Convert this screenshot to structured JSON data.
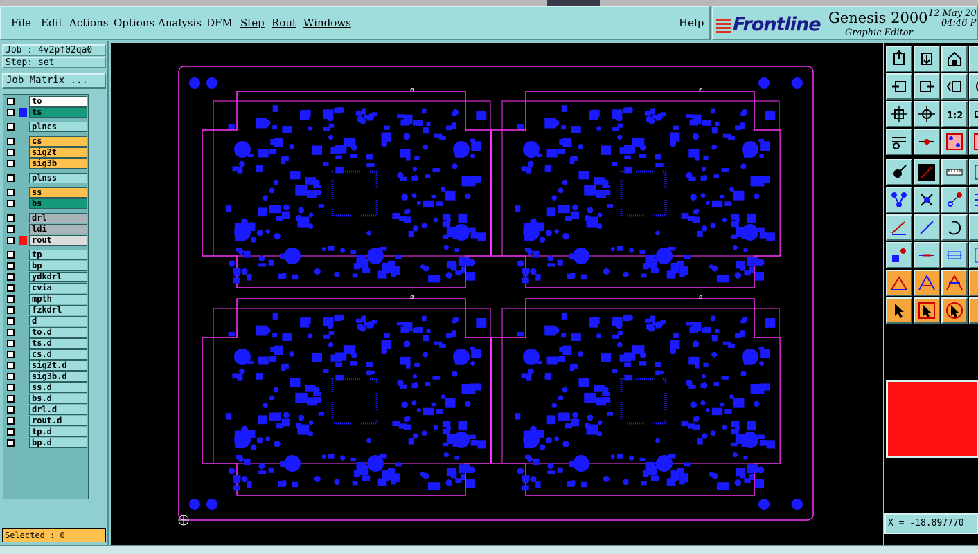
{
  "menubar": {
    "items": [
      {
        "label": "File"
      },
      {
        "label": "Edit"
      },
      {
        "label": "Actions"
      },
      {
        "label": "Options"
      },
      {
        "label": "Analysis"
      },
      {
        "label": "DFM"
      },
      {
        "label": "Step"
      },
      {
        "label": "Rout"
      },
      {
        "label": "Windows"
      }
    ],
    "help_label": "Help"
  },
  "brand": {
    "logo_text": "Frontline",
    "product": "Genesis 2000",
    "subtitle": "Graphic Editor",
    "date": "12 May 20",
    "time": "04:46 P"
  },
  "job": {
    "label": "Job : 4v2pf02qa0",
    "step": "Step: set",
    "matrix_button": "Job Matrix ..."
  },
  "layers": [
    {
      "name": "to",
      "bg": "#ffffff",
      "selected": false
    },
    {
      "name": "ts",
      "bg": "#159a7c",
      "selected": true
    },
    {
      "name": "plncs",
      "bg": "#9fdcdc"
    },
    {
      "name": "cs",
      "bg": "#ffc14d"
    },
    {
      "name": "sig2t",
      "bg": "#ffc14d"
    },
    {
      "name": "sig3b",
      "bg": "#ffc14d"
    },
    {
      "name": "plnss",
      "bg": "#9fdcdc"
    },
    {
      "name": "ss",
      "bg": "#ffc14d"
    },
    {
      "name": "bs",
      "bg": "#159a7c"
    },
    {
      "name": "drl",
      "bg": "#a9b5b9"
    },
    {
      "name": "ldi",
      "bg": "#a9b5b9"
    },
    {
      "name": "rout",
      "bg": "#dcdcdc",
      "marker": "#ff1111"
    },
    {
      "name": "tp",
      "bg": "#9fdcdc"
    },
    {
      "name": "bp",
      "bg": "#9fdcdc"
    },
    {
      "name": "ydkdrl",
      "bg": "#9fdcdc"
    },
    {
      "name": "cvia",
      "bg": "#9fdcdc"
    },
    {
      "name": "mpth",
      "bg": "#9fdcdc"
    },
    {
      "name": "fzkdrl",
      "bg": "#9fdcdc"
    },
    {
      "name": "d",
      "bg": "#9fdcdc"
    },
    {
      "name": "to.d",
      "bg": "#9fdcdc"
    },
    {
      "name": "ts.d",
      "bg": "#9fdcdc"
    },
    {
      "name": "cs.d",
      "bg": "#9fdcdc"
    },
    {
      "name": "sig2t.d",
      "bg": "#9fdcdc"
    },
    {
      "name": "sig3b.d",
      "bg": "#9fdcdc"
    },
    {
      "name": "ss.d",
      "bg": "#9fdcdc"
    },
    {
      "name": "bs.d",
      "bg": "#9fdcdc"
    },
    {
      "name": "drl.d",
      "bg": "#9fdcdc"
    },
    {
      "name": "rout.d",
      "bg": "#9fdcdc"
    },
    {
      "name": "tp.d",
      "bg": "#9fdcdc"
    },
    {
      "name": "bp.d",
      "bg": "#9fdcdc"
    }
  ],
  "selected_label": "Selected : 0",
  "coords": "X = -18.897770",
  "colors": {
    "pads": "#1a1aff",
    "outline": "#ff33ff",
    "canvas": "#000000",
    "panel": "#9fdcdc"
  },
  "toolbar_icons": [
    "move-to-top-icon",
    "move-to-bottom-icon",
    "home-icon",
    "lock-icon",
    "pan-left-icon",
    "pan-right-icon",
    "zoom-back-icon",
    "zoom-icon",
    "fit-screen-icon",
    "center-icon",
    "one-to-one-icon",
    "measure-icon",
    "tools-icon",
    "snap-icon",
    "nets-icon",
    "layer-icon",
    "feature-select-icon",
    "draw-mode-icon",
    "ruler-icon",
    "grid-icon",
    "nodes-icon",
    "cross-icon",
    "net-icon",
    "connect-icon",
    "line-icon",
    "slash-icon",
    "arc-icon",
    "vertical-line-icon",
    "pad-icon",
    "dash-icon",
    "fit-icon",
    "snap-pad-icon",
    "triangle-icon",
    "triangle-alt-icon",
    "triangle-frame-icon",
    "triangle-edge-icon",
    "pointer-icon",
    "pointer-box-icon",
    "pointer-select-icon",
    "pointer-edge-icon"
  ]
}
